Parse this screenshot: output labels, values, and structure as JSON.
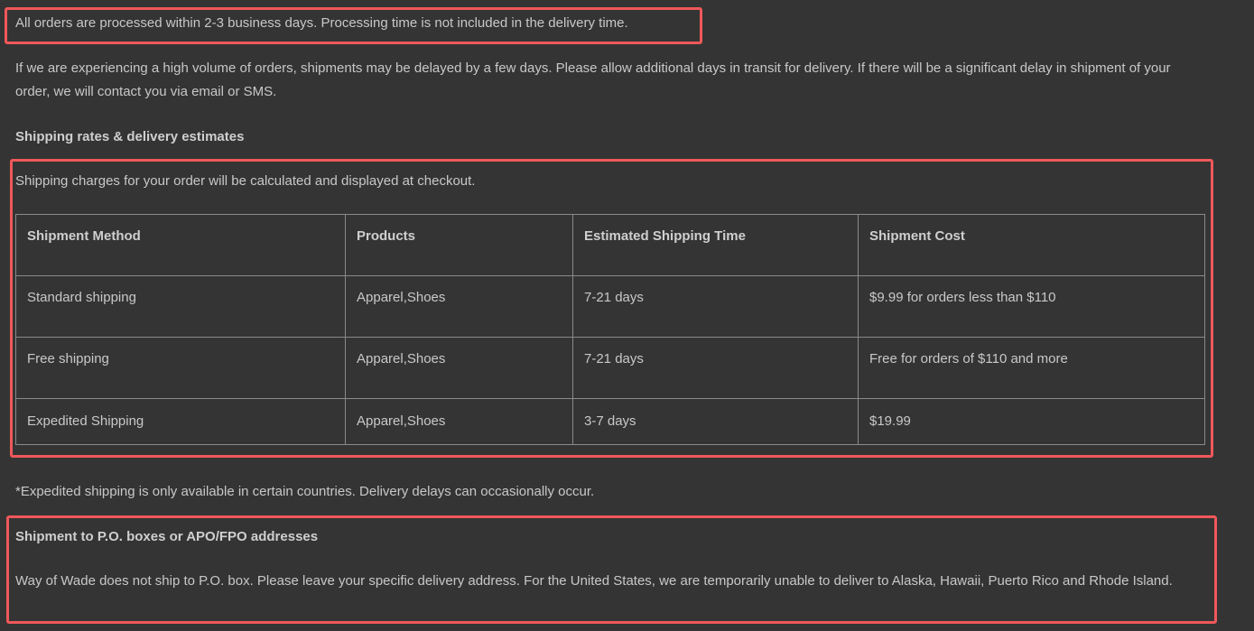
{
  "processing_note": "All orders are processed within 2-3 business days. Processing time is not included in the delivery time.",
  "delay_note": "If we are experiencing a high volume of orders, shipments may be delayed by a few days. Please allow additional days in transit for delivery. If there will be a significant delay in shipment of your order, we will contact you via email or SMS.",
  "rates_heading": "Shipping rates & delivery estimates",
  "charges_note": "Shipping charges for your order will be calculated and displayed at checkout.",
  "table": {
    "headers": [
      "Shipment Method",
      "Products",
      "Estimated Shipping Time",
      "Shipment Cost"
    ],
    "rows": [
      [
        "Standard shipping",
        "Apparel,Shoes",
        "7-21 days",
        "$9.99 for orders less than $110"
      ],
      [
        "Free shipping",
        "Apparel,Shoes",
        "7-21 days",
        "Free for orders of $110 and more"
      ],
      [
        "Expedited Shipping",
        "Apparel,Shoes",
        "3-7 days",
        "$19.99"
      ]
    ]
  },
  "expedited_note": "*Expedited shipping is only available in certain countries. Delivery delays can occasionally occur.",
  "po_heading": "Shipment to P.O. boxes or APO/FPO addresses",
  "po_note": "Way of Wade does not ship to P.O. box. Please leave your specific delivery address. For the United States, we are temporarily unable to deliver to Alaska, Hawaii, Puerto Rico and Rhode Island.",
  "colors": {
    "background": "#343434",
    "text": "#c8c8c8",
    "highlight": "#f0585a",
    "table_border": "#8a8a8a"
  }
}
